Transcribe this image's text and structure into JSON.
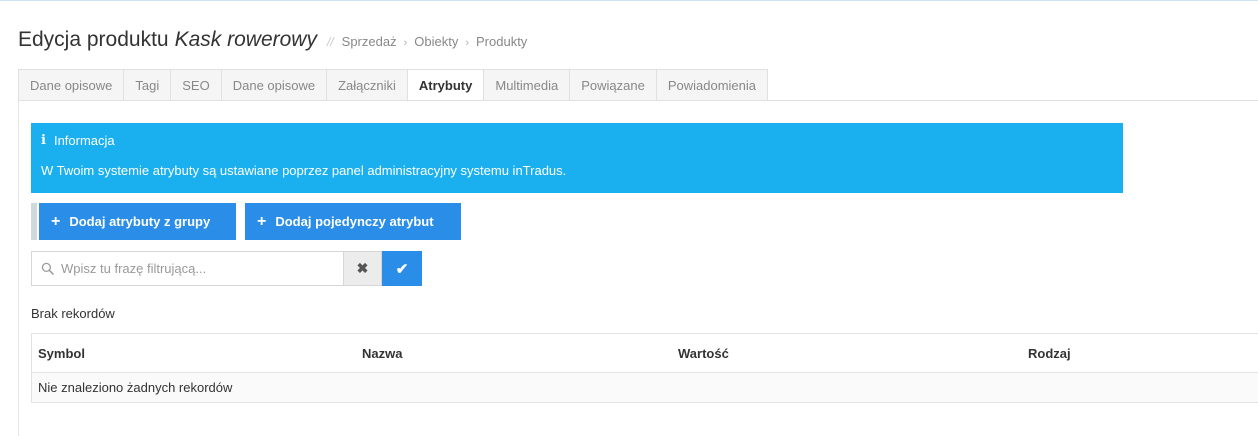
{
  "header": {
    "title": "Edycja produktu",
    "product_name": "Kask rowerowy",
    "separator": "//",
    "breadcrumb": [
      "Sprzedaż",
      "Obiekty",
      "Produkty"
    ],
    "breadcrumb_chevron": "›"
  },
  "tabs": [
    {
      "label": "Dane opisowe",
      "active": false
    },
    {
      "label": "Tagi",
      "active": false
    },
    {
      "label": "SEO",
      "active": false
    },
    {
      "label": "Dane opisowe",
      "active": false
    },
    {
      "label": "Załączniki",
      "active": false
    },
    {
      "label": "Atrybuty",
      "active": true
    },
    {
      "label": "Multimedia",
      "active": false
    },
    {
      "label": "Powiązane",
      "active": false
    },
    {
      "label": "Powiadomienia",
      "active": false
    }
  ],
  "info": {
    "icon": "info-icon",
    "icon_glyph": "i",
    "heading": "Informacja",
    "text": "W Twoim systemie atrybuty są ustawiane poprzez panel administracyjny systemu inTradus."
  },
  "actions": {
    "add_group_label": "Dodaj atrybuty z grupy",
    "add_single_label": "Dodaj pojedynczy atrybut",
    "plus_glyph": "+"
  },
  "filter": {
    "placeholder": "Wpisz tu frazę filtrującą...",
    "value": "",
    "clear_glyph": "✖",
    "apply_glyph": "✔"
  },
  "table": {
    "empty_caption": "Brak rekordów",
    "columns": [
      "Symbol",
      "Nazwa",
      "Wartość",
      "Rodzaj"
    ],
    "empty_message": "Nie znaleziono żadnych rekordów",
    "rows": []
  },
  "colors": {
    "accent": "#2a8de8",
    "info_bg": "#1ab0f0"
  }
}
